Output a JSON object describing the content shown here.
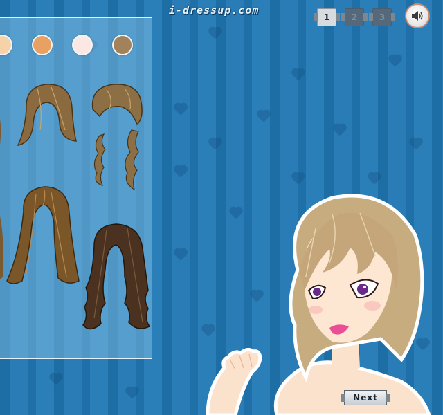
{
  "header": {
    "logo_text": "i-dressup.com"
  },
  "pager": {
    "pages": [
      {
        "label": "1",
        "active": true
      },
      {
        "label": "2",
        "active": false
      },
      {
        "label": "3",
        "active": false
      }
    ]
  },
  "sound": {
    "icon": "speaker-icon"
  },
  "palette": {
    "skin_tones": [
      "#f6d2a8",
      "#e8a163",
      "#fbe8e4",
      "#a2825a"
    ]
  },
  "hairstyles": [
    {
      "name": "short-bob",
      "color": "#8a6a3e"
    },
    {
      "name": "curly-updo",
      "color": "#8d6f45"
    },
    {
      "name": "long-straight",
      "color": "#7a5628"
    },
    {
      "name": "long-wavy-dark",
      "color": "#4b3220"
    }
  ],
  "navigation": {
    "next_label": "Next"
  },
  "colors": {
    "accent": "#2a7cb6",
    "panel_border": "#e6f2fb"
  }
}
